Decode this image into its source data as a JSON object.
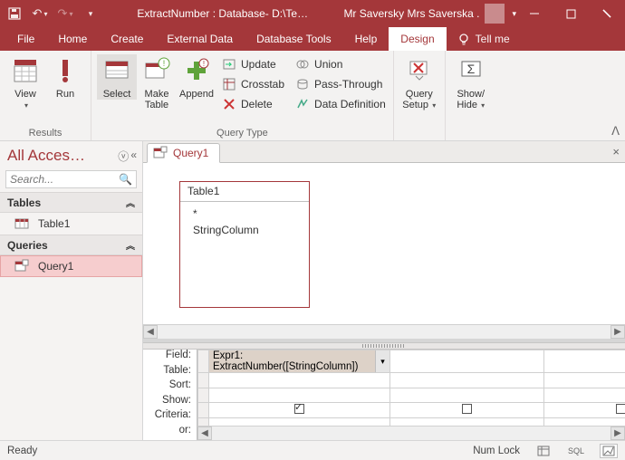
{
  "titlebar": {
    "title": "ExtractNumber : Database- D:\\Te…",
    "user": "Mr Saversky Mrs Saverska ."
  },
  "tabs": [
    "File",
    "Home",
    "Create",
    "External Data",
    "Database Tools",
    "Help",
    "Design"
  ],
  "active_tab": "Design",
  "tellme": "Tell me",
  "ribbon": {
    "results": {
      "label": "Results",
      "view": "View",
      "run": "Run"
    },
    "querytype": {
      "label": "Query Type",
      "select": "Select",
      "maketable": "Make\nTable",
      "append": "Append",
      "update": "Update",
      "crosstab": "Crosstab",
      "delete": "Delete",
      "union": "Union",
      "passthrough": "Pass-Through",
      "datadef": "Data Definition"
    },
    "querysetup": {
      "label": "Query\nSetup"
    },
    "showhide": {
      "label": "Show/\nHide"
    }
  },
  "nav": {
    "title": "All Acces…",
    "search_ph": "Search...",
    "tables": "Tables",
    "table1": "Table1",
    "queries": "Queries",
    "query1": "Query1"
  },
  "doc": {
    "tab": "Query1",
    "tablebox": {
      "title": "Table1",
      "star": "*",
      "col": "StringColumn"
    }
  },
  "grid": {
    "labels": [
      "Field:",
      "Table:",
      "Sort:",
      "Show:",
      "Criteria:",
      "or:"
    ],
    "field_expr": "Expr1: ExtractNumber([StringColumn])"
  },
  "status": {
    "ready": "Ready",
    "numlock": "Num Lock",
    "sql": "SQL"
  }
}
